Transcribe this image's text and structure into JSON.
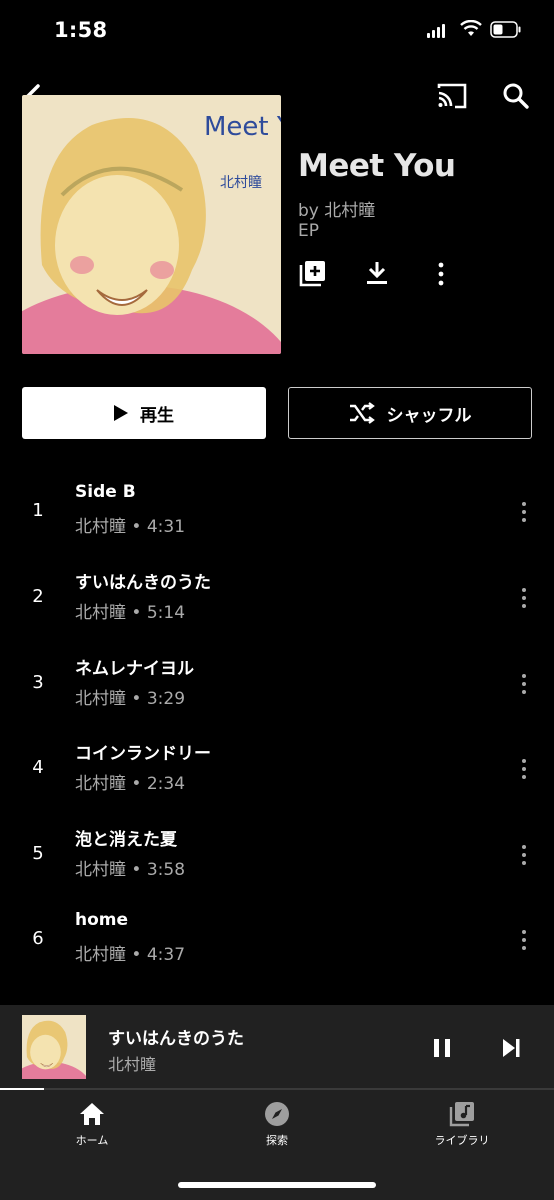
{
  "status_bar": {
    "time": "1:58"
  },
  "album": {
    "title": "Meet You",
    "by_line": "by 北村瞳",
    "type": "EP",
    "art_text": "Meet You",
    "art_artist": "北村瞳"
  },
  "actions": {
    "play_label": "再生",
    "shuffle_label": "シャッフル"
  },
  "tracks": [
    {
      "num": "1",
      "title": "Side B",
      "sub": "北村瞳 • 4:31"
    },
    {
      "num": "2",
      "title": "すいはんきのうた",
      "sub": "北村瞳 • 5:14"
    },
    {
      "num": "3",
      "title": "ネムレナイヨル",
      "sub": "北村瞳 • 3:29"
    },
    {
      "num": "4",
      "title": "コインランドリー",
      "sub": "北村瞳 • 2:34"
    },
    {
      "num": "5",
      "title": "泡と消えた夏",
      "sub": "北村瞳 • 3:58"
    },
    {
      "num": "6",
      "title": "home",
      "sub": "北村瞳 • 4:37"
    }
  ],
  "mini_player": {
    "title": "すいはんきのうた",
    "artist": "北村瞳",
    "progress": 0.08
  },
  "nav": {
    "home": "ホーム",
    "explore": "探索",
    "library": "ライブラリ"
  },
  "icons": [
    "back-icon",
    "cast-icon",
    "search-icon",
    "add-to-library-icon",
    "download-icon",
    "more-vert-icon",
    "play-icon",
    "shuffle-icon",
    "pause-icon",
    "skip-next-icon",
    "home-icon",
    "compass-icon",
    "library-icon"
  ]
}
